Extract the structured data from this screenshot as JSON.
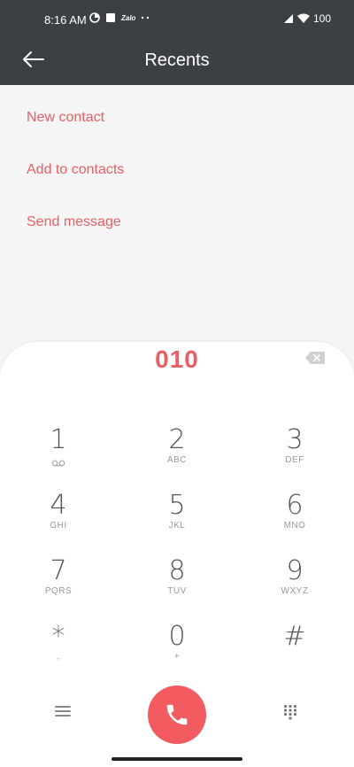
{
  "status_bar": {
    "time": "8:16 AM",
    "battery": "100",
    "app_label": "Zalo"
  },
  "app_bar": {
    "title": "Recents",
    "back_icon": "arrow-left-icon"
  },
  "actions": [
    {
      "label": "New contact"
    },
    {
      "label": "Add to contacts"
    },
    {
      "label": "Send message"
    }
  ],
  "dialer": {
    "number": "010",
    "keys": [
      {
        "digit": "1",
        "letters": ""
      },
      {
        "digit": "2",
        "letters": "ABC"
      },
      {
        "digit": "3",
        "letters": "DEF"
      },
      {
        "digit": "4",
        "letters": "GHI"
      },
      {
        "digit": "5",
        "letters": "JKL"
      },
      {
        "digit": "6",
        "letters": "MNO"
      },
      {
        "digit": "7",
        "letters": "PQRS"
      },
      {
        "digit": "8",
        "letters": "TUV"
      },
      {
        "digit": "9",
        "letters": "WXYZ"
      },
      {
        "digit": "*",
        "letters": ","
      },
      {
        "digit": "0",
        "letters": "+"
      },
      {
        "digit": "#",
        "letters": ""
      }
    ]
  },
  "colors": {
    "accent": "#e66066",
    "call_button": "#f25c61",
    "top_bar": "#3c3f44"
  }
}
